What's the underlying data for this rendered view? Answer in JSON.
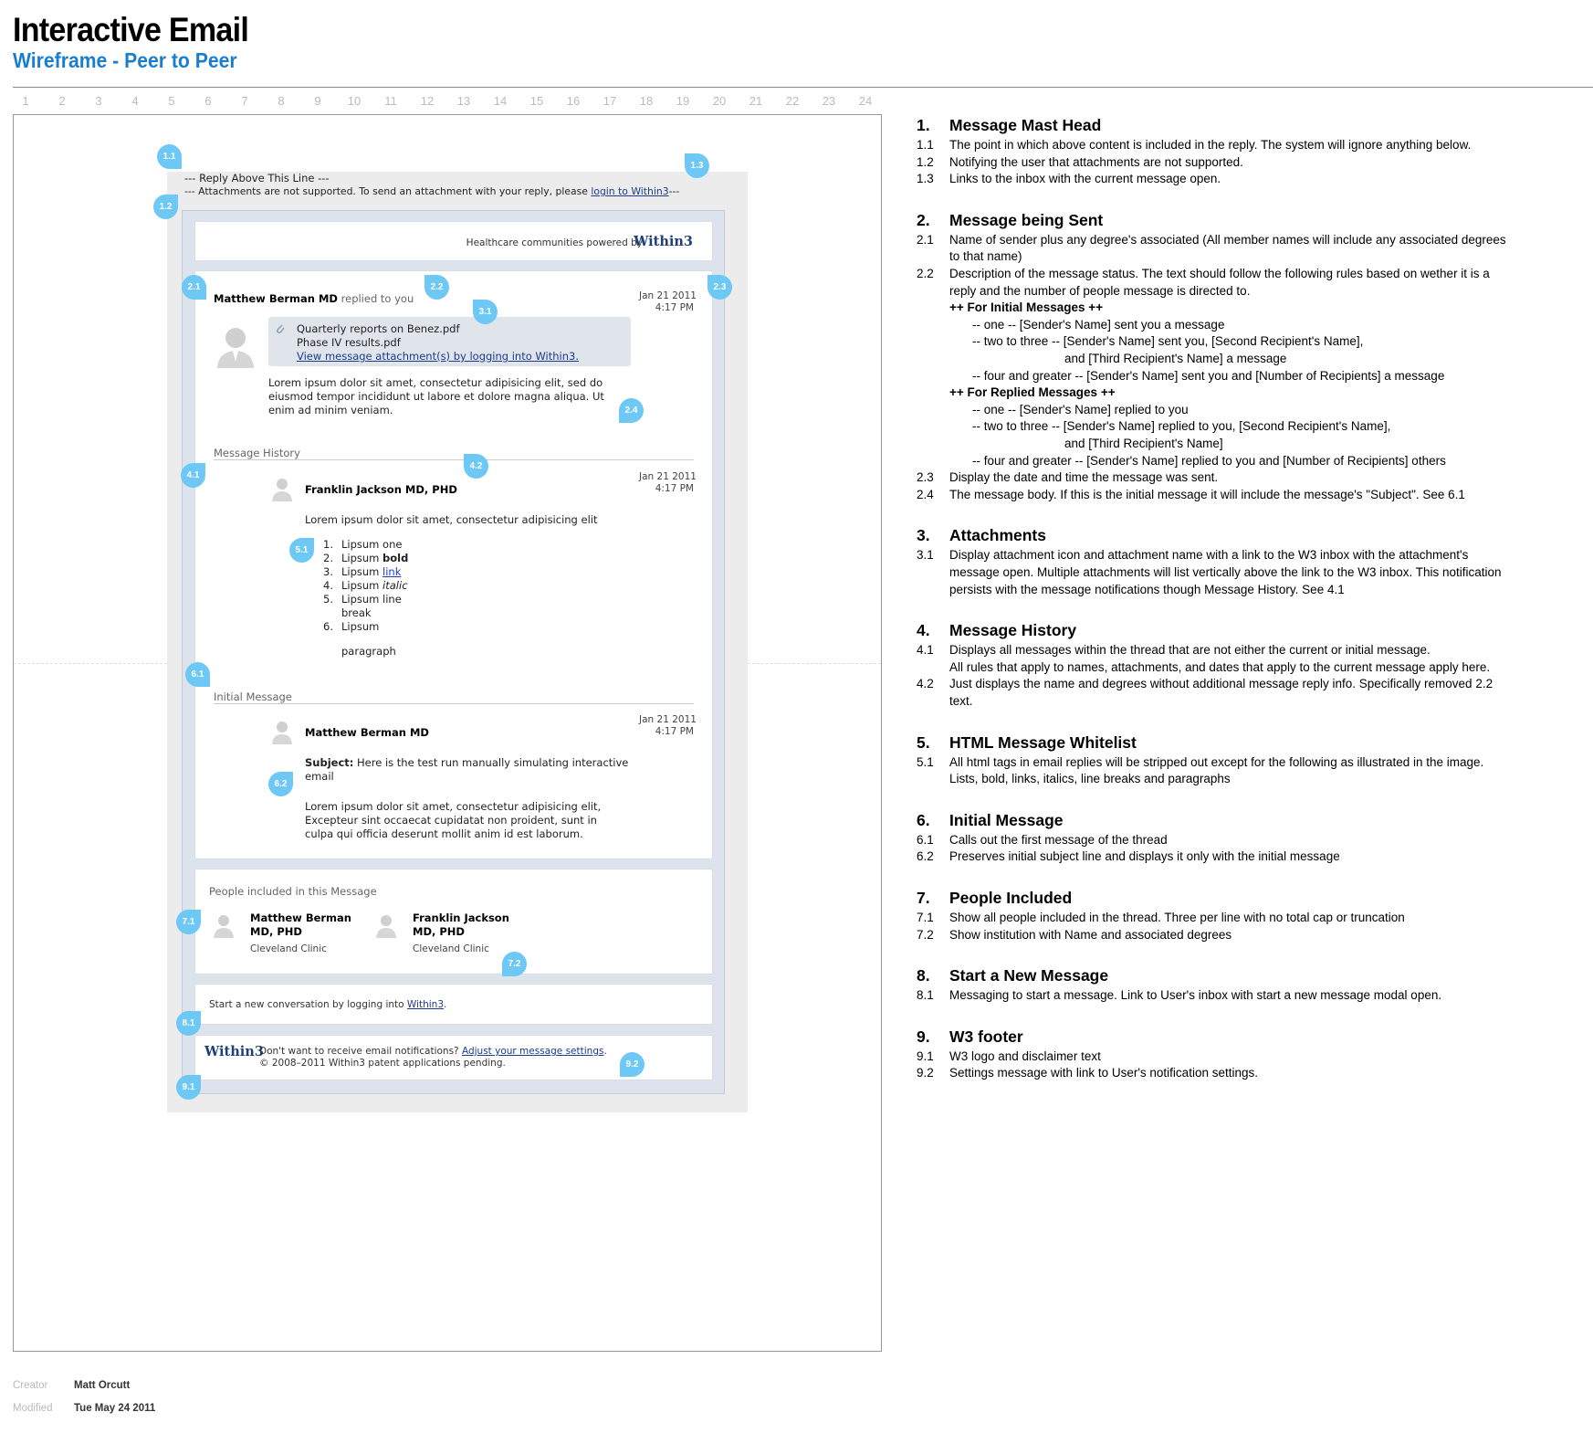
{
  "header": {
    "title": "Interactive Email",
    "subtitle": "Wireframe - Peer to Peer"
  },
  "columns": [
    "1",
    "2",
    "3",
    "4",
    "5",
    "6",
    "7",
    "8",
    "9",
    "10",
    "11",
    "12",
    "13",
    "14",
    "15",
    "16",
    "17",
    "18",
    "19",
    "20",
    "21",
    "22",
    "23",
    "24"
  ],
  "email": {
    "reply_line": "--- Reply Above This Line ---",
    "attach_prefix": "--- Attachments are not supported. To send an attachment with your reply, please ",
    "attach_link": "login to Within3",
    "attach_suffix": "---",
    "brand_tagline": "Healthcare communities powered by",
    "brand_logo": "Within3",
    "current": {
      "sender": "Matthew Berman MD",
      "status": " replied to you",
      "date": "Jan 21 2011",
      "time": "4:17 PM",
      "attachments": [
        "Quarterly reports on Benez.pdf",
        "Phase IV results.pdf"
      ],
      "attach_link": "View message attachment(s) by logging into Within3.",
      "body": [
        "Lorem ipsum dolor sit amet, consectetur adipisicing elit, sed do",
        "eiusmod tempor incididunt ut labore et dolore magna aliqua. Ut",
        "enim ad minim veniam."
      ]
    },
    "history": {
      "label": "Message History",
      "sender": "Franklin Jackson MD, PHD",
      "date": "Jan 21 2011",
      "time": "4:17 PM",
      "body": "Lorem ipsum dolor sit amet, consectetur adipisicing elit",
      "list": [
        {
          "n": "1.",
          "pre": "Lipsum",
          "val": "one"
        },
        {
          "n": "2.",
          "pre": "Lipsum",
          "val": "bold"
        },
        {
          "n": "3.",
          "pre": "Lipsum",
          "val": "link"
        },
        {
          "n": "4.",
          "pre": "Lipsum",
          "val": "italic"
        },
        {
          "n": "5.",
          "pre": "Lipsum",
          "val": "line"
        },
        {
          "n": "",
          "pre": "break",
          "val": ""
        },
        {
          "n": "6.",
          "pre": "Lipsum",
          "val": ""
        }
      ],
      "paragraph": "paragraph"
    },
    "initial": {
      "label": "Initial Message",
      "sender": "Matthew Berman MD",
      "date": "Jan 21 2011",
      "time": "4:17 PM",
      "subject_label": "Subject:",
      "subject": " Here is the test run manually simulating interactive",
      "subject2": "email",
      "body": [
        "Lorem ipsum dolor sit amet, consectetur adipisicing elit,",
        "Excepteur sint occaecat cupidatat non proident, sunt in",
        "culpa qui officia deserunt mollit anim id est laborum."
      ]
    },
    "people": {
      "label": "People included in this Message",
      "list": [
        {
          "name1": "Matthew Berman",
          "name2": "MD, PHD",
          "org": "Cleveland Clinic"
        },
        {
          "name1": "Franklin Jackson",
          "name2": "MD, PHD",
          "org": "Cleveland Clinic"
        }
      ]
    },
    "new_conv": {
      "prefix": "Start a new conversation by logging into ",
      "link": "Within3",
      "suffix": "."
    },
    "footer": {
      "logo": "Within3",
      "line1": "Don't want to receive email notifications? ",
      "link": "Adjust your message settings",
      "line1_end": ".",
      "line2": "© 2008–2011 Within3 patent applications pending."
    }
  },
  "pins": [
    "1.1",
    "1.2",
    "1.3",
    "2.1",
    "2.2",
    "2.3",
    "2.4",
    "3.1",
    "4.1",
    "4.2",
    "5.1",
    "6.1",
    "6.2",
    "7.1",
    "7.2",
    "8.1",
    "9.1",
    "9.2"
  ],
  "notes": [
    {
      "num": "1.",
      "title": "Message Mast Head",
      "items": [
        {
          "n": "1.1",
          "t": "The point in which above content is included in the reply. The system will ignore anything below."
        },
        {
          "n": "1.2",
          "t": "Notifying the user that attachments are not supported."
        },
        {
          "n": "1.3",
          "t": "Links to the inbox with the current message open."
        }
      ]
    },
    {
      "num": "2.",
      "title": "Message being Sent",
      "items": [
        {
          "n": "2.1",
          "t": "Name of sender plus any degree's associated (All member names will include any associated degrees"
        },
        {
          "n": "",
          "t": "to that name)"
        },
        {
          "n": "2.2",
          "t": "Description of the message status. The text should follow the following rules based on wether it is a"
        },
        {
          "n": "",
          "t": "reply and the number of people message is directed to."
        },
        {
          "n": "",
          "t": "++  For Initial Messages  ++",
          "bold": true,
          "indent": 1
        },
        {
          "n": "",
          "t": "-- one --  [Sender's Name] sent you a message",
          "indent": 2
        },
        {
          "n": "",
          "t": "-- two to three --  [Sender's Name] sent you, [Second Recipient's Name],",
          "indent": 2
        },
        {
          "n": "",
          "t": "and [Third Recipient's Name] a message",
          "indent": 3
        },
        {
          "n": "",
          "t": "-- four and greater -- [Sender's Name] sent you and [Number of Recipients] a message",
          "indent": 2
        },
        {
          "n": "",
          "t": "++  For Replied Messages  ++",
          "bold": true,
          "indent": 1
        },
        {
          "n": "",
          "t": "-- one --  [Sender's Name] replied to you",
          "indent": 2
        },
        {
          "n": "",
          "t": "-- two to three --  [Sender's Name] replied to you, [Second Recipient's Name],",
          "indent": 2
        },
        {
          "n": "",
          "t": "and [Third Recipient's Name]",
          "indent": 3
        },
        {
          "n": "",
          "t": "-- four and greater -- [Sender's Name] replied to you and [Number of Recipients] others",
          "indent": 2
        },
        {
          "n": "2.3",
          "t": "Display the date and time the message was sent."
        },
        {
          "n": "2.4",
          "t": "The message body. If this is the initial message it will include the message's \"Subject\". See 6.1"
        }
      ]
    },
    {
      "num": "3.",
      "title": "Attachments",
      "items": [
        {
          "n": "3.1",
          "t": "Display attachment icon and attachment name with a link to the W3 inbox with the attachment's"
        },
        {
          "n": "",
          "t": "message open. Multiple attachments will list vertically above the link to the W3 inbox. This notification"
        },
        {
          "n": "",
          "t": "persists with the message notifications though Message History. See 4.1"
        }
      ]
    },
    {
      "num": "4.",
      "title": "Message History",
      "items": [
        {
          "n": "4.1",
          "t": "Displays all messages within the thread that are not either the current or initial message."
        },
        {
          "n": "",
          "t": "All rules that apply to names, attachments, and dates that apply to the current message apply here."
        },
        {
          "n": "4.2",
          "t": "Just displays the name and degrees without additional message reply info. Specifically removed 2.2"
        },
        {
          "n": "",
          "t": "text."
        }
      ]
    },
    {
      "num": "5.",
      "title": "HTML Message Whitelist",
      "items": [
        {
          "n": "5.1",
          "t": "All html tags in email replies will be stripped out except for the following as illustrated in the image."
        },
        {
          "n": "",
          "t": "Lists, bold, links, italics, line breaks and paragraphs"
        }
      ]
    },
    {
      "num": "6.",
      "title": "Initial Message",
      "items": [
        {
          "n": "6.1",
          "t": "Calls out the first message of the thread"
        },
        {
          "n": "6.2",
          "t": "Preserves initial subject line and displays it only with the initial message"
        }
      ]
    },
    {
      "num": "7.",
      "title": "People Included",
      "items": [
        {
          "n": "7.1",
          "t": "Show all people included in the thread. Three per line with no total cap or truncation"
        },
        {
          "n": "7.2",
          "t": "Show institution with Name and associated degrees"
        }
      ]
    },
    {
      "num": "8.",
      "title": "Start a New Message",
      "items": [
        {
          "n": "8.1",
          "t": "Messaging to start a message. Link to User's inbox with start a new message modal open."
        }
      ]
    },
    {
      "num": "9.",
      "title": "W3 footer",
      "items": [
        {
          "n": "9.1",
          "t": "W3 logo and disclaimer text"
        },
        {
          "n": "9.2",
          "t": "Settings message with link to User's notification settings."
        }
      ]
    }
  ],
  "meta": {
    "creator_label": "Creator",
    "creator": "Matt Orcutt",
    "modified_label": "Modified",
    "modified": "Tue May 24 2011"
  }
}
